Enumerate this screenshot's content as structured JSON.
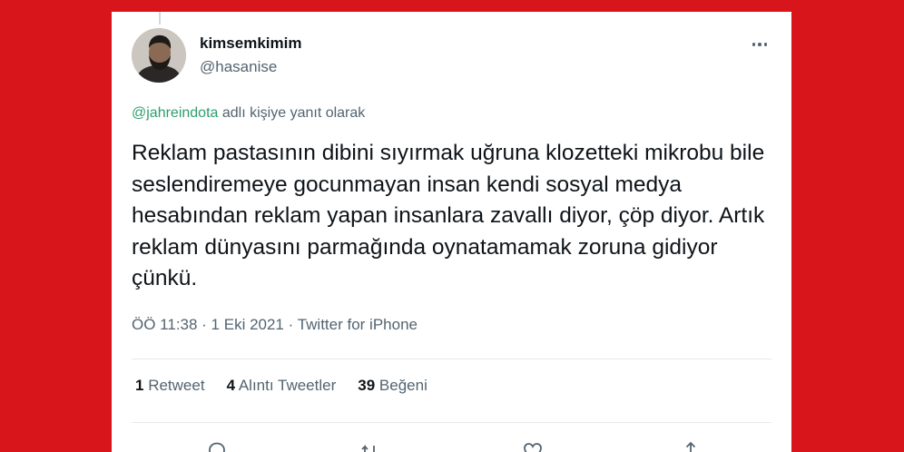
{
  "tweet": {
    "display_name": "kimsemkimim",
    "handle": "@hasanise",
    "reply_mention": "@jahreindota",
    "reply_suffix": "adlı kişiye yanıt olarak",
    "text": "Reklam pastasının dibini sıyırmak uğruna klozetteki mikrobu bile seslendiremeye gocunmayan insan kendi sosyal medya hesabından reklam yapan insanlara zavallı diyor, çöp diyor. Artık reklam dünyasını parmağında oynatamamak zoruna gidiyor çünkü.",
    "timestamp": "ÖÖ 11:38 · 1 Eki 2021 · Twitter for iPhone"
  },
  "stats": {
    "retweets_count": "1",
    "retweets_label": "Retweet",
    "quotes_count": "4",
    "quotes_label": "Alıntı Tweetler",
    "likes_count": "39",
    "likes_label": "Beğeni"
  },
  "colors": {
    "background": "#d8151b",
    "mention": "#2e9d6e",
    "text": "#0f1419",
    "secondary": "#536471"
  },
  "icons": {
    "more": "more-horizontal-icon",
    "reply": "comment-icon",
    "retweet": "retweet-icon",
    "like": "heart-icon",
    "share": "share-icon"
  }
}
